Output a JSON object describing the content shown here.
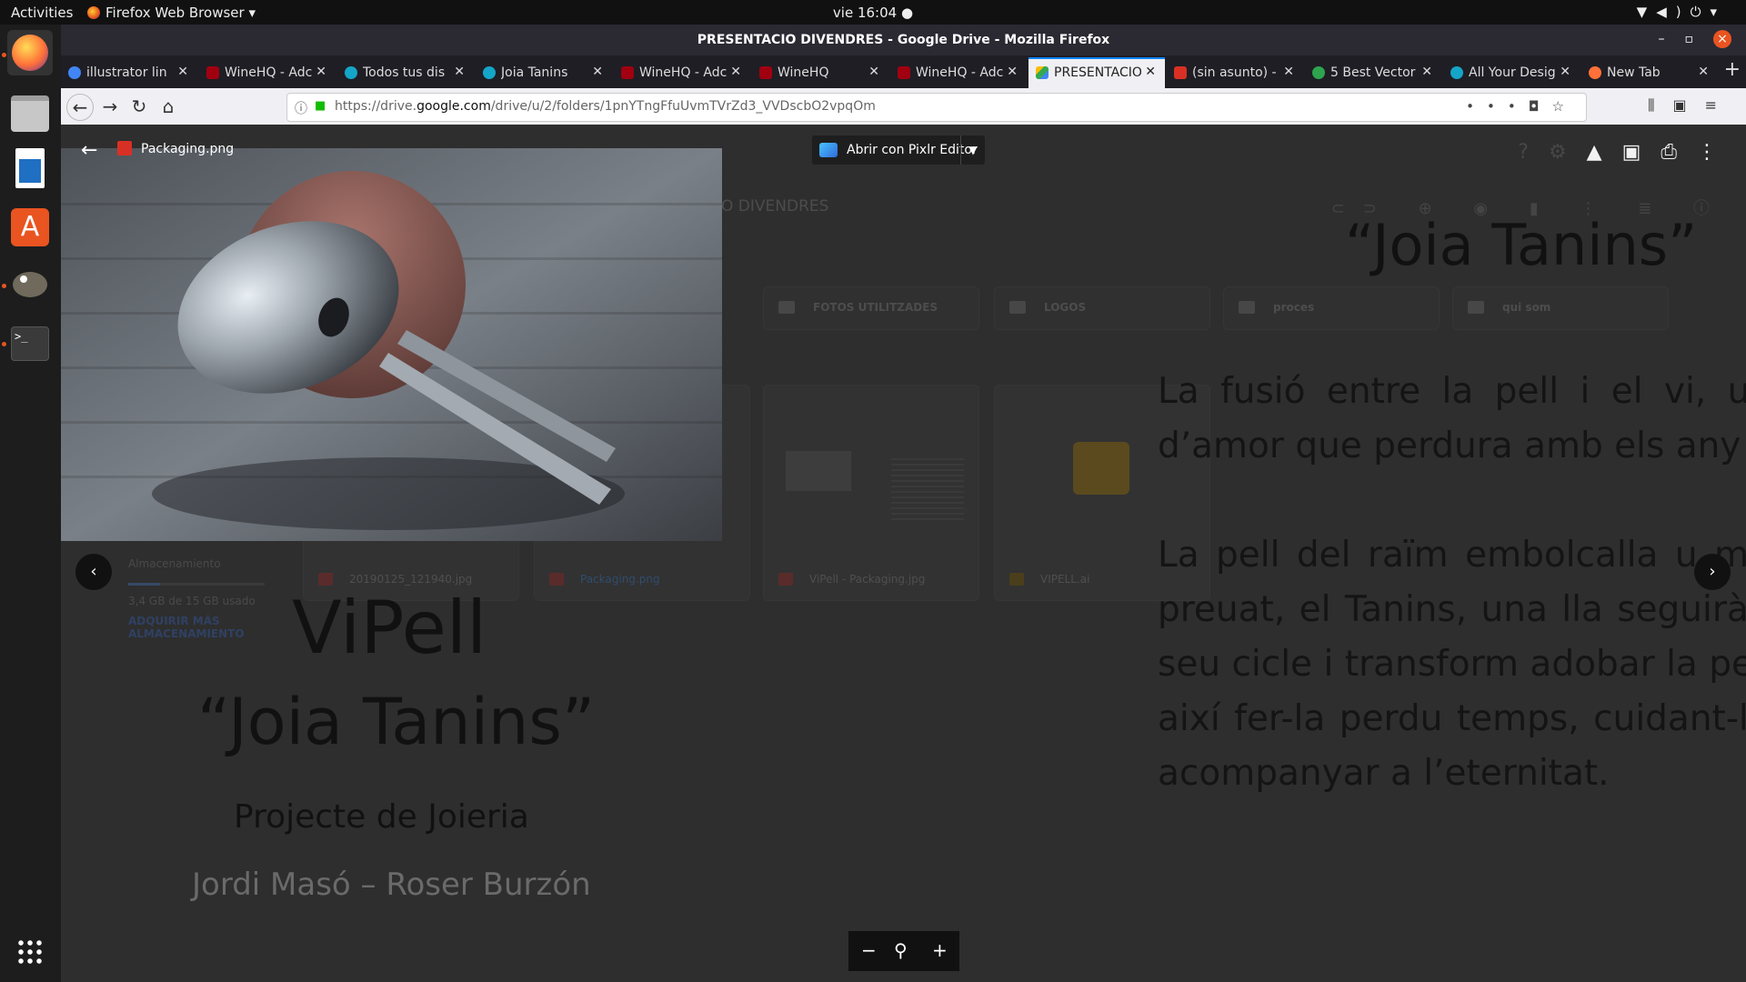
{
  "topbar": {
    "activities": "Activities",
    "app_name": "Firefox Web Browser",
    "clock": "vie 16:04"
  },
  "window": {
    "title": "PRESENTACIO DIVENDRES - Google Drive - Mozilla Firefox"
  },
  "tabs": [
    {
      "label": "illustrator lin",
      "favicon_color": "#4285f4"
    },
    {
      "label": "WineHQ - Adc",
      "favicon_color": "#a00010"
    },
    {
      "label": "Todos tus dis",
      "favicon_color": "#15a5c8"
    },
    {
      "label": "Joia Tanins",
      "favicon_color": "#15a5c8"
    },
    {
      "label": "WineHQ - Adc",
      "favicon_color": "#a00010"
    },
    {
      "label": "WineHQ",
      "favicon_color": "#a00010"
    },
    {
      "label": "WineHQ - Adc",
      "favicon_color": "#a00010"
    },
    {
      "label": "PRESENTACIO",
      "favicon_color": "#fbbc04",
      "active": true
    },
    {
      "label": "(sin asunto) -",
      "favicon_color": "#d93025"
    },
    {
      "label": "5 Best Vector",
      "favicon_color": "#2ea44f"
    },
    {
      "label": "All Your Desig",
      "favicon_color": "#15a5c8"
    },
    {
      "label": "New Tab",
      "favicon_color": "#ff7139"
    }
  ],
  "navbar": {
    "url_prefix": "https://drive.",
    "url_domain": "google.com",
    "url_rest": "/drive/u/2/folders/1pnYTngFfuUvmTVrZd3_VVDscbO2vpqOm"
  },
  "viewer": {
    "file_name": "Packaging.png",
    "open_with_label": "Abrir con Pixlr Editor"
  },
  "drive": {
    "breadcrumb": "O DIVENDRES",
    "folders": [
      "FOTOS UTILITZADES",
      "LOGOS",
      "proces",
      "qui som"
    ],
    "files": [
      "20190125_121940.jpg",
      "Packaging.png",
      "ViPell - Packaging.jpg",
      "VIPELL.ai"
    ],
    "storage_label": "Almacenamiento",
    "storage_used": "3,4 GB de 15 GB usado",
    "storage_fraction": 0.23,
    "buy_storage": "ADQUIRIR MÁS ALMACENAMIENTO"
  },
  "slide": {
    "brand": "ViPell",
    "product": "“Joia Tanins”",
    "subtitle": "Projecte de Joieria",
    "authors": "Jordi Masó – Roser Burzón",
    "right_title": "“Joia Tanins”",
    "paragraph1": "La fusió entre la pell i el vi, una d’amor que perdura amb els any",
    "paragraph2": "La pell del raïm embolcalla u molt preuat, el Tanins, una lla seguirà el seu cicle i transform adobar la pell i així fer-la perdu temps, cuidant-la i acompanyar a l’eternitat."
  },
  "colors": {
    "accent": "#e95420",
    "firefox_blue": "#0a84ff"
  },
  "icons": {
    "zoom_out": "−",
    "zoom": "⚲",
    "zoom_in": "+"
  }
}
